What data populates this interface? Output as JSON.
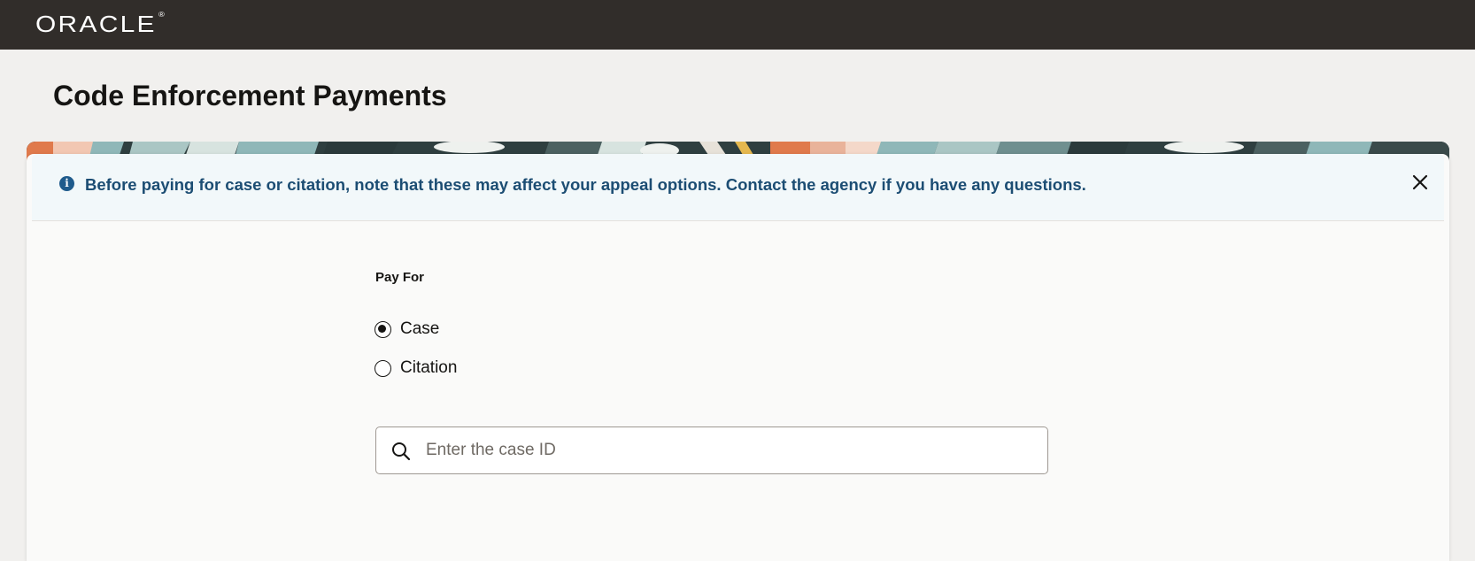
{
  "header": {
    "logo_text": "ORACLE"
  },
  "page": {
    "title": "Code Enforcement Payments"
  },
  "info_message": {
    "text": "Before paying for case or citation, note that these may affect your appeal options. Contact the agency if you have any questions.",
    "icon": "info-icon",
    "close_icon": "close-icon"
  },
  "form": {
    "pay_for_label": "Pay For",
    "options": [
      {
        "label": "Case",
        "selected": true
      },
      {
        "label": "Citation",
        "selected": false
      }
    ],
    "search": {
      "value": "",
      "placeholder": "Enter the case ID",
      "icon": "search-icon"
    }
  },
  "colors": {
    "header_bg": "#312d2a",
    "info_text": "#1c4d73",
    "info_bg": "#f2f8fa",
    "page_bg": "#f1f0ee"
  }
}
